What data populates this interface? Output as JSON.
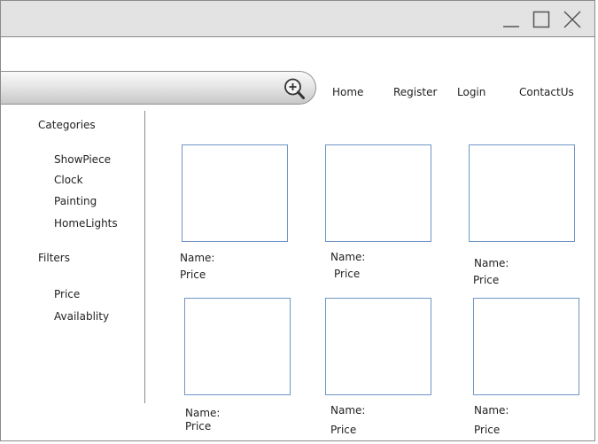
{
  "window": {
    "icons": [
      "minimize-icon",
      "maximize-icon",
      "close-icon"
    ]
  },
  "search": {
    "icon": "search-zoom-in-icon"
  },
  "nav": {
    "home": "Home",
    "register": "Register",
    "login": "Login",
    "contact": "ContactUs"
  },
  "sidebar": {
    "categories_heading": "Categories",
    "categories": [
      "ShowPiece",
      "Clock",
      "Painting",
      "HomeLights"
    ],
    "filters_heading": "Filters",
    "filters": [
      "Price",
      "Availablity"
    ]
  },
  "products": [
    {
      "name_label": "Name:",
      "price_label": "Price"
    },
    {
      "name_label": "Name:",
      "price_label": "Price"
    },
    {
      "name_label": "Name:",
      "price_label": "Price"
    },
    {
      "name_label": "Name:",
      "price_label": "Price"
    },
    {
      "name_label": "Name:",
      "price_label": "Price"
    },
    {
      "name_label": "Name:",
      "price_label": "Price"
    }
  ]
}
